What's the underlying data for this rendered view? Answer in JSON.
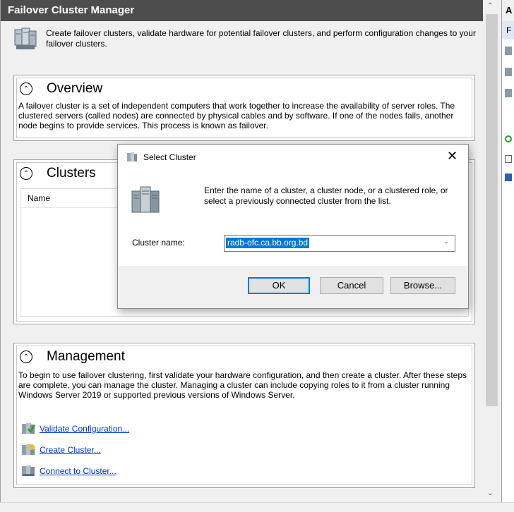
{
  "window": {
    "title": "Failover Cluster Manager"
  },
  "intro": {
    "text": "Create failover clusters, validate hardware for potential failover clusters, and perform configuration changes to your failover clusters."
  },
  "overview": {
    "title": "Overview",
    "text": "A failover cluster is a set of independent computers that work together to increase the availability of server roles. The clustered servers (called nodes) are connected by physical cables and by software. If one of the nodes fails, another node begins to provide services. This process is known as failover."
  },
  "clusters": {
    "title": "Clusters",
    "column_name": "Name"
  },
  "management": {
    "title": "Management",
    "text": "To begin to use failover clustering, first validate your hardware configuration, and then create a cluster. After these steps are complete, you can manage the cluster. Managing a cluster can include copying roles to it from a cluster running Windows Server 2019 or supported previous versions of Windows Server.",
    "links": [
      "Validate Configuration...",
      "Create Cluster...",
      "Connect to Cluster..."
    ]
  },
  "right_pane": {
    "header": "A",
    "row": "F"
  },
  "dialog": {
    "title": "Select Cluster",
    "instruction": "Enter the name of a cluster, a cluster node, or a clustered role, or select a previously connected cluster from the list.",
    "field_label": "Cluster name:",
    "field_value": "radb-ofc.ca.bb.org.bd",
    "ok": "OK",
    "cancel": "Cancel",
    "browse": "Browse..."
  },
  "colors": {
    "titlebar": "#4d4d4d",
    "link": "#0033cc",
    "selection": "#0078d7"
  }
}
